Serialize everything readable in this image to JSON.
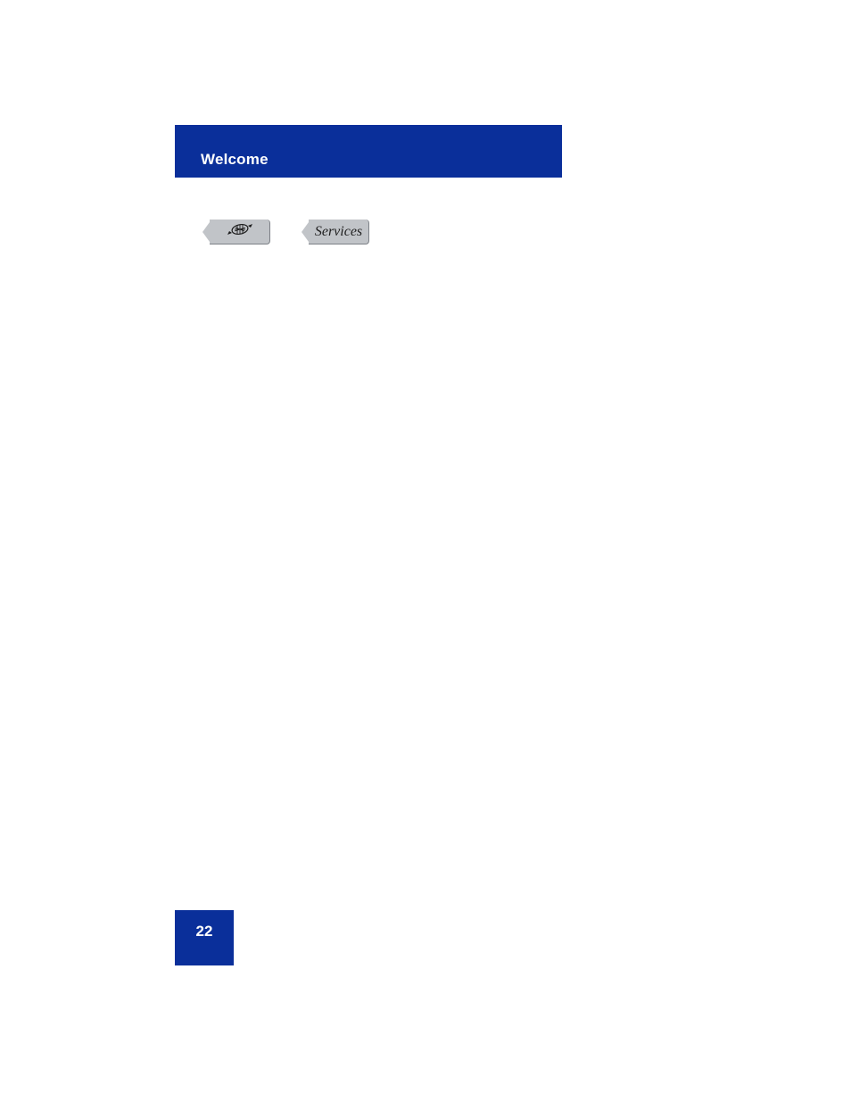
{
  "header": {
    "title": "Welcome"
  },
  "buttons": {
    "services_label": "Services"
  },
  "footer": {
    "page_number": "22"
  }
}
